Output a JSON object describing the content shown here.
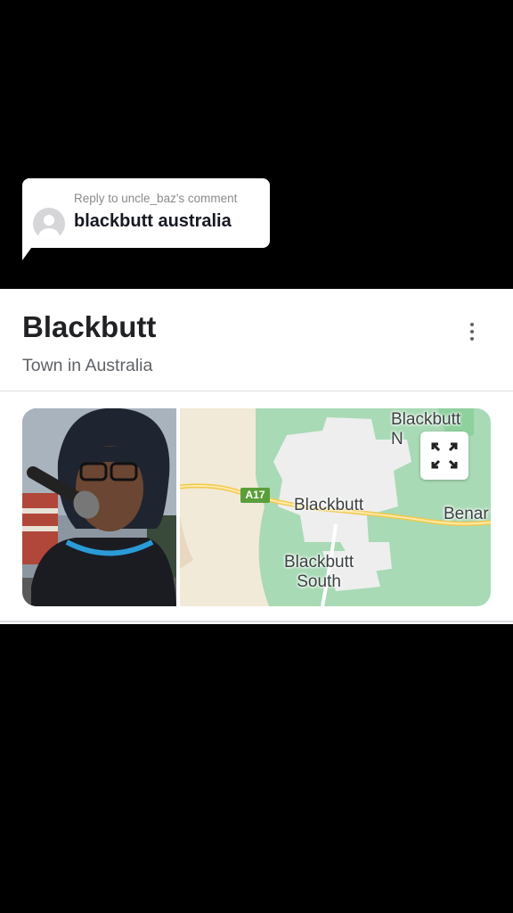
{
  "reply": {
    "caption": "Reply to uncle_baz's comment",
    "text": "blackbutt australia"
  },
  "card": {
    "title": "Blackbutt",
    "subtitle": "Town in Australia",
    "more_icon": "more-vertical-icon",
    "map": {
      "labels": {
        "north": "Blackbutt\nN",
        "town": "Blackbutt",
        "south": "Blackbutt\nSouth",
        "east": "Benar"
      },
      "road": "A17",
      "expand_icon": "expand-icon"
    }
  }
}
